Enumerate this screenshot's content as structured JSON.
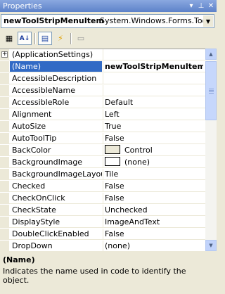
{
  "window": {
    "title": "Properties"
  },
  "object_selector": {
    "name": "newToolStripMenuItem",
    "type": "System.Windows.Forms.ToolStri"
  },
  "toolbar": {
    "buttons": [
      {
        "icon": "categorized-icon",
        "glyph": "▦"
      },
      {
        "icon": "alphabetical-icon",
        "glyph": "A↓"
      },
      {
        "icon": "properties-icon",
        "glyph": "▤"
      },
      {
        "icon": "events-icon",
        "glyph": "⚡"
      },
      {
        "icon": "property-pages-icon",
        "glyph": "▭"
      }
    ]
  },
  "properties": [
    {
      "name": "(ApplicationSettings)",
      "value": "",
      "expandable": true
    },
    {
      "name": "(Name)",
      "value": "newToolStripMenuItem",
      "selected": true
    },
    {
      "name": "AccessibleDescription",
      "value": ""
    },
    {
      "name": "AccessibleName",
      "value": ""
    },
    {
      "name": "AccessibleRole",
      "value": "Default"
    },
    {
      "name": "Alignment",
      "value": "Left"
    },
    {
      "name": "AutoSize",
      "value": "True"
    },
    {
      "name": "AutoToolTip",
      "value": "False"
    },
    {
      "name": "BackColor",
      "value": "Control",
      "swatch": "#ece9d8"
    },
    {
      "name": "BackgroundImage",
      "value": "(none)",
      "swatch": "#ffffff"
    },
    {
      "name": "BackgroundImageLayout",
      "value": "Tile"
    },
    {
      "name": "Checked",
      "value": "False"
    },
    {
      "name": "CheckOnClick",
      "value": "False"
    },
    {
      "name": "CheckState",
      "value": "Unchecked"
    },
    {
      "name": "DisplayStyle",
      "value": "ImageAndText"
    },
    {
      "name": "DoubleClickEnabled",
      "value": "False"
    },
    {
      "name": "DropDown",
      "value": "(none)"
    }
  ],
  "description": {
    "title": "(Name)",
    "text": "Indicates the name used in code to identify the object."
  },
  "colors": {
    "selection": "#316ac5",
    "titlebar": "#6f90d4",
    "chrome": "#ece9d8"
  }
}
